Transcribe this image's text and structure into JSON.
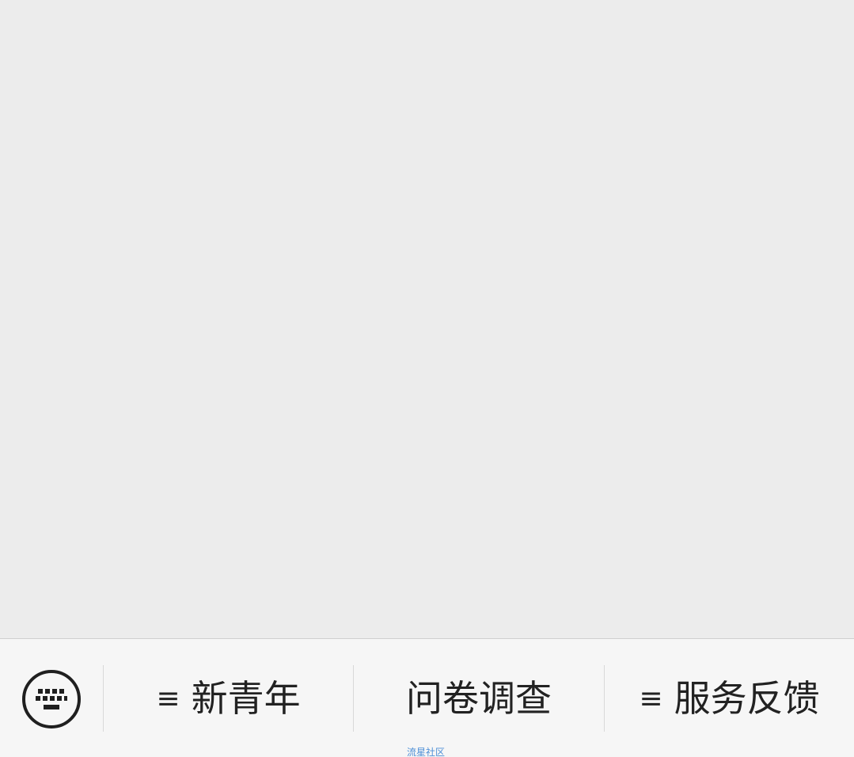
{
  "bottom_menu": {
    "keyboard_toggle": {
      "icon": "keyboard-icon"
    },
    "items": [
      {
        "label": "新青年",
        "has_submenu": true,
        "icon": "menu-lines-icon",
        "icon_glyph": "≡"
      },
      {
        "label": "问卷调查",
        "has_submenu": false
      },
      {
        "label": "服务反馈",
        "has_submenu": true,
        "icon": "menu-lines-icon",
        "icon_glyph": "≡"
      }
    ]
  },
  "watermark": {
    "text": "流星社区"
  },
  "colors": {
    "content_background": "#ececec",
    "bar_background": "#f6f6f6",
    "text": "#222222",
    "watermark": "#4d8fd6",
    "divider": "#d8d8d8"
  }
}
